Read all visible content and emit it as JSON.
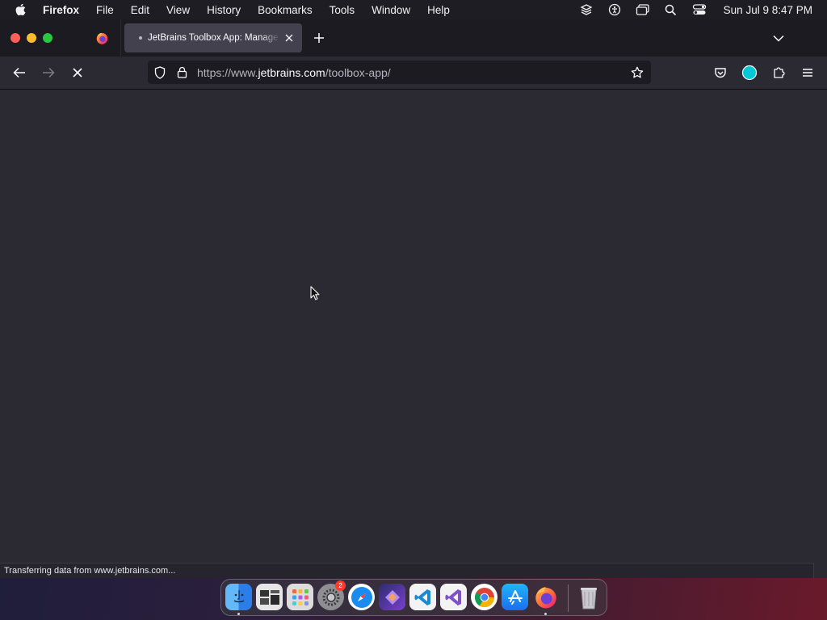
{
  "menubar": {
    "app_name": "Firefox",
    "items": [
      "File",
      "Edit",
      "View",
      "History",
      "Bookmarks",
      "Tools",
      "Window",
      "Help"
    ],
    "clock": "Sun Jul 9  8:47 PM"
  },
  "tab": {
    "title": "JetBrains Toolbox App: Manage",
    "state": "loading"
  },
  "urlbar": {
    "url_prefix": "https://www.",
    "url_host": "jetbrains.com",
    "url_path": "/toolbox-app/"
  },
  "status": {
    "text": "Transferring data from www.jetbrains.com..."
  },
  "dock": {
    "apps": [
      "finder-icon",
      "screenshot-icon",
      "launchpad-icon",
      "system-settings-icon",
      "safari-icon",
      "affinity-icon",
      "vscode-icon",
      "visual-studio-icon",
      "chrome-icon",
      "app-store-icon",
      "firefox-icon",
      "trash-icon"
    ],
    "settings_badge": "2"
  },
  "colors": {
    "menubar_bg": "#1e1d24",
    "tab_active": "#42414d",
    "toolbar_bg": "#2b2a33",
    "urlbar_bg": "#1c1b22",
    "content_bg": "#2b2a33"
  }
}
